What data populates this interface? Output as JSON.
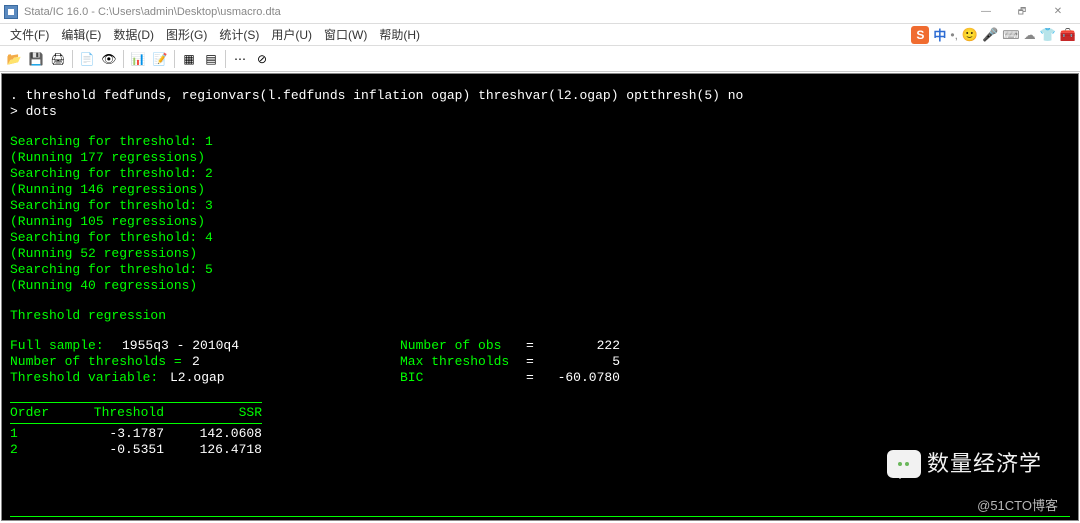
{
  "window": {
    "title": "Stata/IC 16.0 - C:\\Users\\admin\\Desktop\\usmacro.dta"
  },
  "menus": {
    "file": "文件(F)",
    "edit": "编辑(E)",
    "data": "数据(D)",
    "graph": "图形(G)",
    "stats": "统计(S)",
    "user": "用户(U)",
    "window": "窗口(W)",
    "help": "帮助(H)"
  },
  "ime": {
    "s_label": "S",
    "cn_label": "中",
    "punct": "•,",
    "kbd": "⌨",
    "cloud": "☁"
  },
  "command": {
    "line1": ". threshold fedfunds, regionvars(l.fedfunds inflation ogap) threshvar(l2.ogap) optthresh(5) no",
    "line2": "> dots"
  },
  "search": {
    "s1": "Searching for threshold: 1",
    "r1": "(Running 177 regressions)",
    "s2": "Searching for threshold: 2",
    "r2": "(Running 146 regressions)",
    "s3": "Searching for threshold: 3",
    "r3": "(Running 105 regressions)",
    "s4": "Searching for threshold: 4",
    "r4": "(Running 52 regressions)",
    "s5": "Searching for threshold: 5",
    "r5": "(Running 40 regressions)"
  },
  "header": "Threshold regression",
  "summary": {
    "full_sample_label": "Full sample:",
    "full_sample_value": "1955q3 - 2010q4",
    "nobs_label": "Number of obs",
    "nobs_eq": "=",
    "nobs_value": "222",
    "nthr_label": "Number of thresholds =",
    "nthr_value": "2",
    "maxthr_label": "Max thresholds",
    "maxthr_eq": "=",
    "maxthr_value": "5",
    "tvar_label": "Threshold variable:",
    "tvar_value": "L2.ogap",
    "bic_label": "BIC",
    "bic_eq": "=",
    "bic_value": "-60.0780"
  },
  "chart_data": {
    "type": "table",
    "columns": [
      "Order",
      "Threshold",
      "SSR"
    ],
    "rows": [
      {
        "order": "1",
        "threshold": "-3.1787",
        "ssr": "142.0608"
      },
      {
        "order": "2",
        "threshold": "-0.5351",
        "ssr": "126.4718"
      }
    ]
  },
  "watermark": {
    "chat": "数量经济学",
    "blog": "@51CTO博客"
  }
}
